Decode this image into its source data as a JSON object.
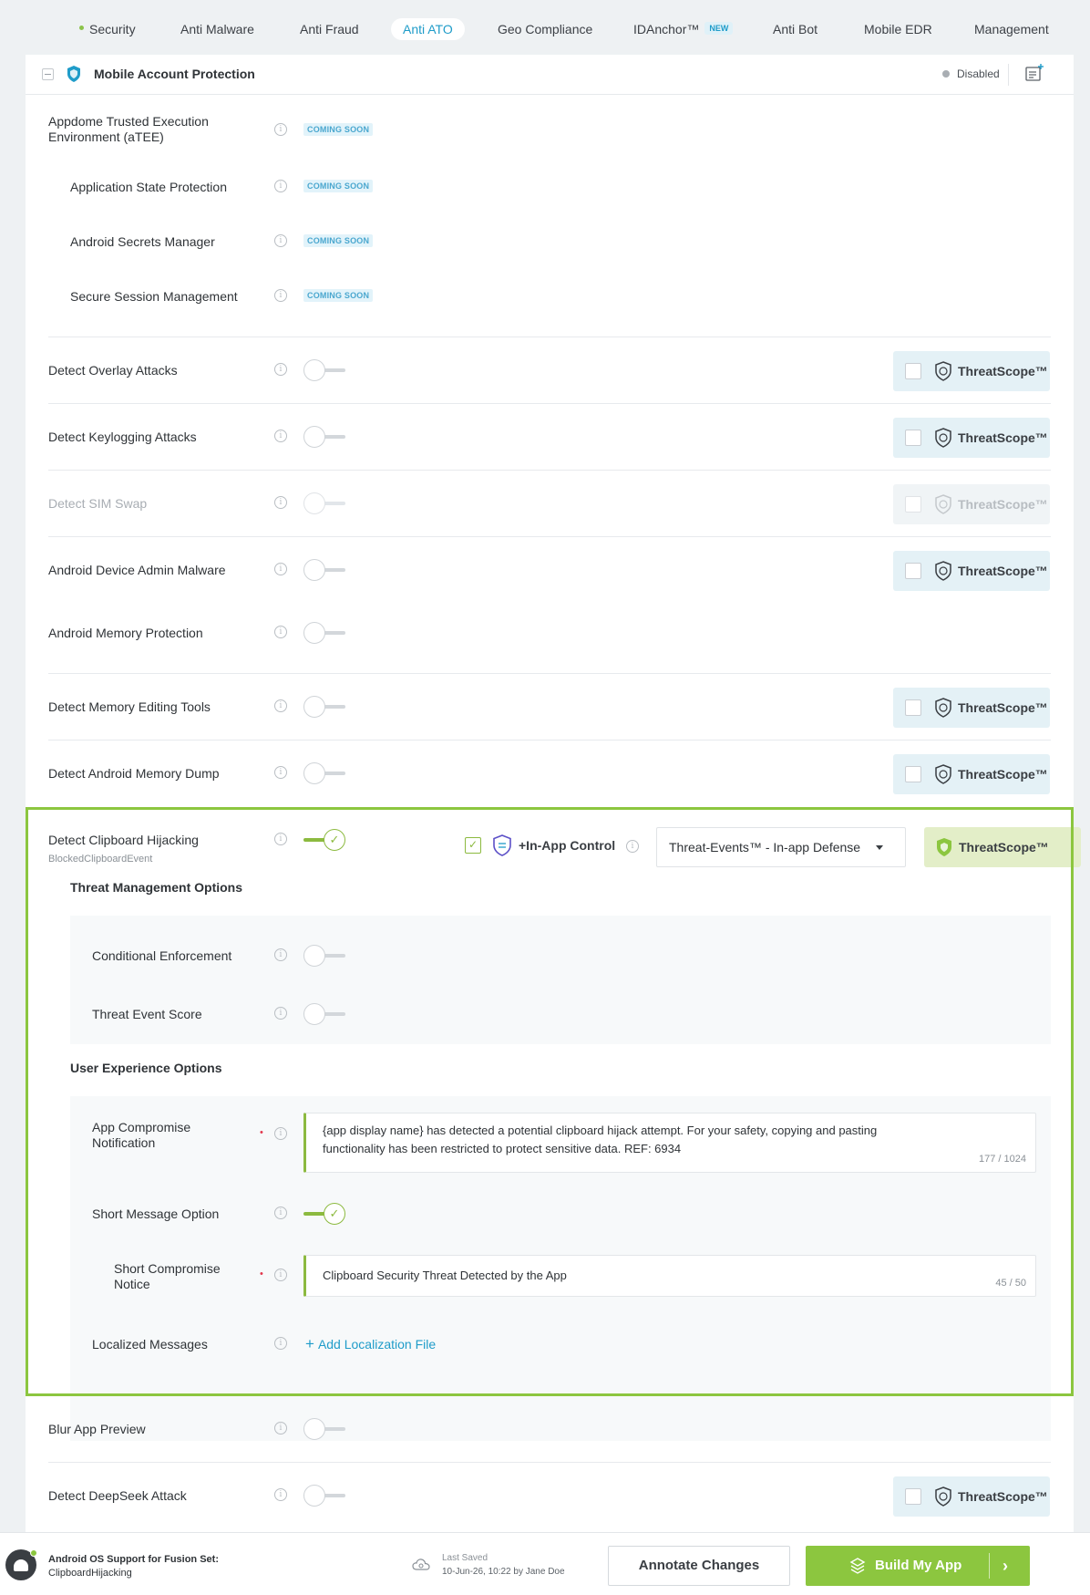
{
  "tabs": [
    {
      "label": "Security"
    },
    {
      "label": "Anti Malware"
    },
    {
      "label": "Anti Fraud"
    },
    {
      "label": "Anti ATO"
    },
    {
      "label": "Geo Compliance"
    },
    {
      "label": "IDAnchor™",
      "badge": "NEW"
    },
    {
      "label": "Anti Bot"
    },
    {
      "label": "Mobile EDR"
    },
    {
      "label": "Management"
    }
  ],
  "section": {
    "title": "Mobile Account Protection",
    "status": "Disabled"
  },
  "coming_soon_label": "COMING SOON",
  "rows": {
    "atee": "Appdome Trusted Execution Environment (aTEE)",
    "app_state": "Application State Protection",
    "secrets": "Android Secrets Manager",
    "session": "Secure Session Management",
    "overlay": "Detect Overlay Attacks",
    "keylog": "Detect Keylogging Attacks",
    "sim": "Detect SIM Swap",
    "admin": "Android Device Admin Malware",
    "memprot": "Android Memory Protection",
    "memedit": "Detect Memory Editing Tools",
    "memdump": "Detect Android Memory Dump",
    "clipboard": "Detect Clipboard Hijacking",
    "clipboard_event": "BlockedClipboardEvent",
    "blur": "Blur App Preview",
    "deepseek": "Detect DeepSeek Attack"
  },
  "threatscope_label": "ThreatScope™",
  "inapp_control": "+In-App Control",
  "dropdown_value": "Threat-Events™ - In-app Defense",
  "threat_mgmt": {
    "title": "Threat Management Options",
    "conditional": "Conditional Enforcement",
    "score": "Threat Event Score"
  },
  "ux": {
    "title": "User Experience Options",
    "app_notif_label": "App Compromise Notification",
    "app_notif_text": "{app display name} has detected a potential clipboard hijack attempt. For your safety, copying and pasting functionality has been restricted to protect sensitive data. REF: 6934",
    "app_notif_count": "177 / 1024",
    "short_option": "Short Message Option",
    "short_notice_label": "Short Compromise Notice",
    "short_notice_text": "Clipboard Security Threat Detected by the App",
    "short_notice_count": "45 / 50",
    "localized": "Localized Messages",
    "add_loc": "Add Localization File"
  },
  "footer": {
    "support_title": "Android OS Support for Fusion Set:",
    "support_name": "ClipboardHijacking",
    "last_saved_label": "Last Saved",
    "last_saved_value": "10-Jun-26, 10:22 by Jane Doe",
    "annotate": "Annotate Changes",
    "build": "Build My App"
  },
  "colors": {
    "accent": "#1f9cc9",
    "green": "#8cc63f"
  }
}
